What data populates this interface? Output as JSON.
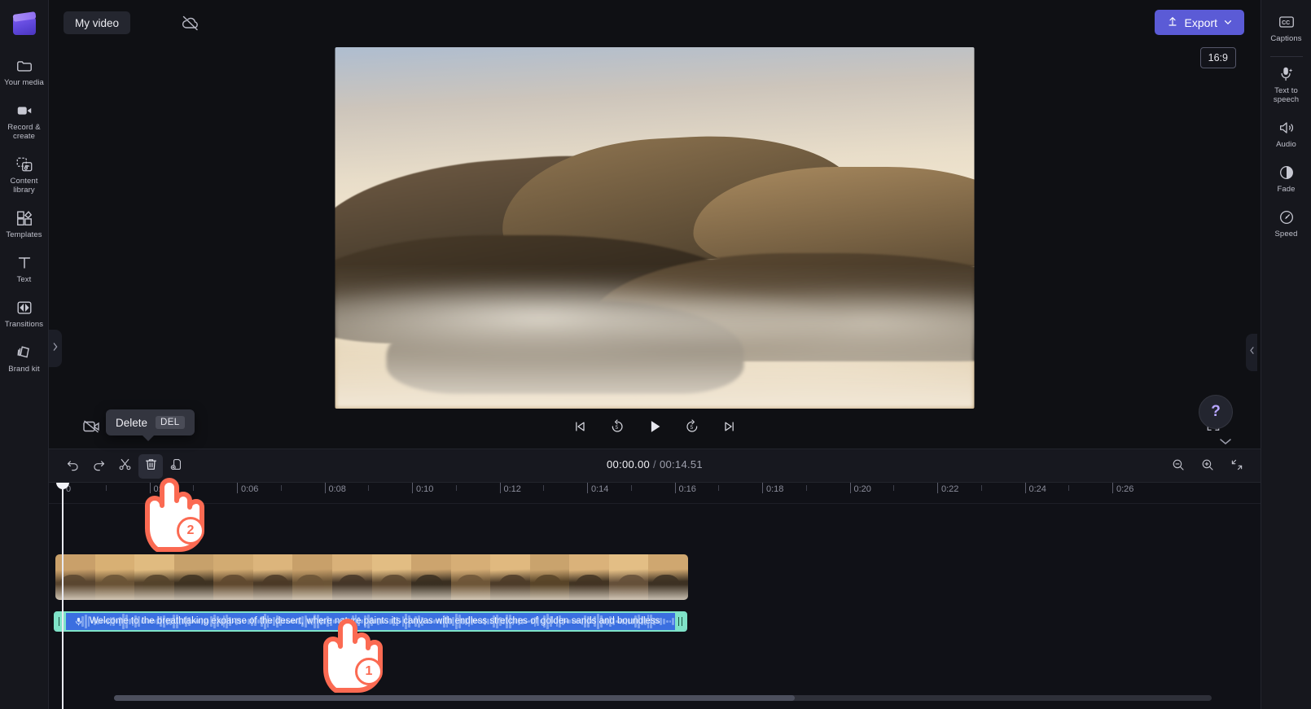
{
  "app": {
    "logo_name": "clipchamp-logo",
    "accent": "#5b5bd6",
    "selection_color": "#7fe3c8",
    "clip_color": "#3b6fe0",
    "cursor_color": "#fb6a52"
  },
  "topbar": {
    "project_title": "My video",
    "cloud_status_icon": "cloud-off-icon",
    "export_label": "Export",
    "export_icon": "upload-icon",
    "export_chevron": "chevron-down-icon"
  },
  "left_rail": {
    "items": [
      {
        "label": "Your media",
        "icon": "folder-icon"
      },
      {
        "label": "Record & create",
        "icon": "video-camera-icon"
      },
      {
        "label": "Content library",
        "icon": "content-library-icon"
      },
      {
        "label": "Templates",
        "icon": "templates-icon"
      },
      {
        "label": "Text",
        "icon": "text-icon"
      },
      {
        "label": "Transitions",
        "icon": "transitions-icon"
      },
      {
        "label": "Brand kit",
        "icon": "brand-kit-icon"
      }
    ],
    "collapse_icon": "chevron-right-icon"
  },
  "right_rail": {
    "items": [
      {
        "label": "Captions",
        "icon": "closed-captions-icon"
      },
      {
        "label": "Text to speech",
        "icon": "microphone-sparkle-icon"
      },
      {
        "label": "Audio",
        "icon": "speaker-icon"
      },
      {
        "label": "Fade",
        "icon": "fade-contrast-icon"
      },
      {
        "label": "Speed",
        "icon": "speedometer-icon"
      }
    ]
  },
  "preview": {
    "aspect_ratio": "16:9",
    "mute_icon": "video-off-icon",
    "fullscreen_icon": "fullscreen-icon",
    "help_label": "?",
    "collapse_icon": "chevron-left-icon",
    "chevron_down_icon": "chevron-down-icon",
    "controls": [
      {
        "name": "skip-to-start-button",
        "icon": "skip-previous-icon"
      },
      {
        "name": "rewind-5-button",
        "icon": "rewind-5-icon"
      },
      {
        "name": "play-button",
        "icon": "play-icon"
      },
      {
        "name": "forward-5-button",
        "icon": "forward-5-icon"
      },
      {
        "name": "skip-to-end-button",
        "icon": "skip-next-icon"
      }
    ]
  },
  "timeline": {
    "tools": [
      {
        "name": "undo-button",
        "icon": "undo-icon",
        "active": false
      },
      {
        "name": "redo-button",
        "icon": "redo-icon",
        "active": false
      },
      {
        "name": "split-button",
        "icon": "scissors-icon",
        "active": false
      },
      {
        "name": "delete-button",
        "icon": "trash-icon",
        "active": true
      },
      {
        "name": "duplicate-button",
        "icon": "duplicate-icon",
        "active": false
      }
    ],
    "current_time": "00:00.00",
    "time_separator": "/",
    "total_time": "00:14.51",
    "zoom_out_icon": "zoom-out-icon",
    "zoom_in_icon": "zoom-in-icon",
    "fit_icon": "fit-to-screen-icon",
    "ruler_labels": [
      "0",
      "0:04",
      "0:06",
      "0:08",
      "0:10",
      "0:12",
      "0:14",
      "0:16",
      "0:18",
      "0:20",
      "0:22",
      "0:24",
      "0:26"
    ],
    "playhead_time": "00:00.00",
    "video_clip": {
      "name": "desert-video-clip"
    },
    "caption_clip": {
      "text": "Welcome to the breathtaking expanse of the desert, where nature paints its canvas with endless stretches of golden sands and boundless",
      "icon": "text-to-speech-icon"
    }
  },
  "tooltip": {
    "label": "Delete",
    "shortcut": "DEL"
  },
  "cursors": [
    {
      "name": "cursor-hand-2",
      "badge": "2"
    },
    {
      "name": "cursor-hand-1",
      "badge": "1"
    }
  ]
}
